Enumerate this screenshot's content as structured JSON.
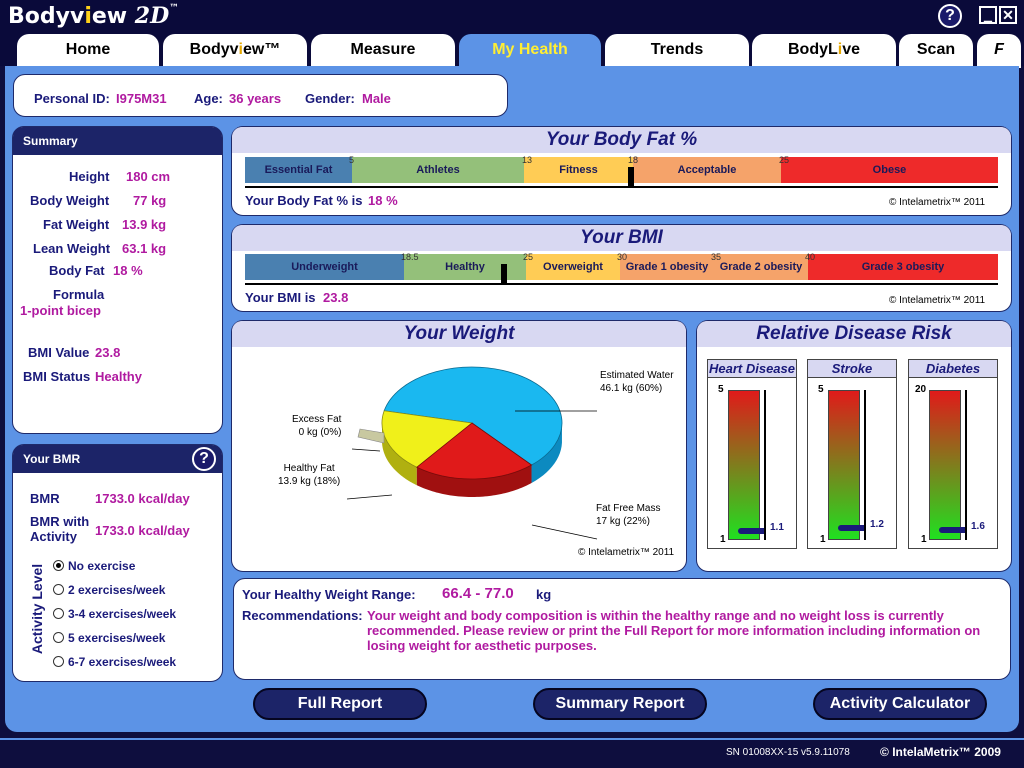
{
  "app": {
    "logo_main": "Bodyv",
    "logo_i": "i",
    "logo_end": "ew",
    "logo_2d": "2D",
    "logo_tm": "™",
    "help_icon": "?",
    "minimize_icon": "▁",
    "close_icon": "✕"
  },
  "tabs": [
    {
      "label": "Home"
    },
    {
      "label": "Bodyv",
      "accent": "i",
      "label2": "ew™"
    },
    {
      "label": "Measure"
    },
    {
      "label": "My Health"
    },
    {
      "label": "Trends"
    },
    {
      "label": "BodyL",
      "accent": "i",
      "label2": "ve"
    },
    {
      "label": "Scan"
    },
    {
      "label": "F"
    }
  ],
  "personal": {
    "id_label": "Personal ID:",
    "id_value": "I975M31",
    "age_label": "Age:",
    "age_value": "36 years",
    "gender_label": "Gender:",
    "gender_value": "Male"
  },
  "summary": {
    "title": "Summary",
    "height_label": "Height",
    "height_value": "180 cm",
    "weight_label": "Body Weight",
    "weight_value": "77 kg",
    "fat_weight_label": "Fat Weight",
    "fat_weight_value": "13.9 kg",
    "lean_label": "Lean Weight",
    "lean_value": "63.1 kg",
    "fat_pct_label": "Body Fat",
    "fat_pct_value": "18 %",
    "formula_label": "Formula",
    "formula_value": "1-point bicep",
    "bmi_value_label": "BMI Value",
    "bmi_value": "23.8",
    "bmi_status_label": "BMI Status",
    "bmi_status": "Healthy"
  },
  "bmr": {
    "title": "Your BMR",
    "help_icon": "?",
    "bmr_label": "BMR",
    "bmr_value": "1733.0 kcal/day",
    "bmr_act_label1": "BMR with",
    "bmr_act_label2": "Activity",
    "bmr_act_value": "1733.0 kcal/day",
    "activity_label": "Activity Level",
    "options": [
      "No exercise",
      "2 exercises/week",
      "3-4 exercises/week",
      "5 exercises/week",
      "6-7 exercises/week"
    ],
    "selected": 0
  },
  "bodyfat": {
    "title": "Your Body Fat %",
    "segments": [
      "Essential Fat",
      "Athletes",
      "Fitness",
      "Acceptable",
      "Obese"
    ],
    "ticks": [
      "5",
      "13",
      "18",
      "25"
    ],
    "result_label": "Your Body Fat % is",
    "result_value": "18 %",
    "value": 18,
    "copyright": "© Intelametrix™ 2011"
  },
  "bmi": {
    "title": "Your BMI",
    "segments": [
      "Underweight",
      "Healthy",
      "Overweight",
      "Grade 1 obesity",
      "Grade 2 obesity",
      "Grade 3 obesity"
    ],
    "ticks": [
      "18.5",
      "25",
      "30",
      "35",
      "40"
    ],
    "result_label": "Your BMI is",
    "result_value": "23.8",
    "value": 23.8,
    "copyright": "© Intelametrix™ 2011"
  },
  "weight": {
    "title": "Your Weight",
    "labels": {
      "water": [
        "Estimated Water",
        "46.1 kg (60%)"
      ],
      "excess": [
        "Excess Fat",
        "0 kg (0%)"
      ],
      "healthy": [
        "Healthy Fat",
        "13.9 kg (18%)"
      ],
      "ffm": [
        "Fat Free Mass",
        "17 kg (22%)"
      ]
    },
    "copyright": "© Intelametrix™ 2011"
  },
  "chart_data": {
    "type": "pie",
    "categories": [
      "Estimated Water",
      "Healthy Fat",
      "Fat Free Mass",
      "Excess Fat"
    ],
    "values": [
      60,
      18,
      22,
      0
    ],
    "title": "Your Weight"
  },
  "risk": {
    "title": "Relative Disease Risk",
    "items": [
      {
        "name": "Heart Disease",
        "max": "5",
        "min": "1",
        "value": "1.1",
        "level": 0.025
      },
      {
        "name": "Stroke",
        "max": "5",
        "min": "1",
        "value": "1.2",
        "level": 0.05
      },
      {
        "name": "Diabetes",
        "max": "20",
        "min": "1",
        "value": "1.6",
        "level": 0.032
      }
    ]
  },
  "healthy_weight": {
    "label": "Your Healthy Weight Range:",
    "value": "66.4 - 77.0",
    "unit": "kg",
    "rec_label": "Recommendations:",
    "rec_text": "Your weight and body composition is within the healthy range and no weight loss is currently recommended. Please review or print the Full Report for more information including information on losing weight for aesthetic purposes."
  },
  "buttons": {
    "full_report": "Full Report",
    "summary_report": "Summary Report",
    "activity_calc": "Activity Calculator"
  },
  "footer": {
    "serial": "SN 01008XX-15 v5.9.11078",
    "copyright_sym": "©",
    "brand": "IntelaMetrix™",
    "year": "2009"
  },
  "colors": {
    "accent": "#5c93e6",
    "dark": "#1c2468",
    "value": "#b01aa0",
    "water": "#1ab8f0",
    "healthy_fat": "#f0f01a",
    "ffm": "#e01a1a",
    "excess": "#c8c8a0"
  }
}
